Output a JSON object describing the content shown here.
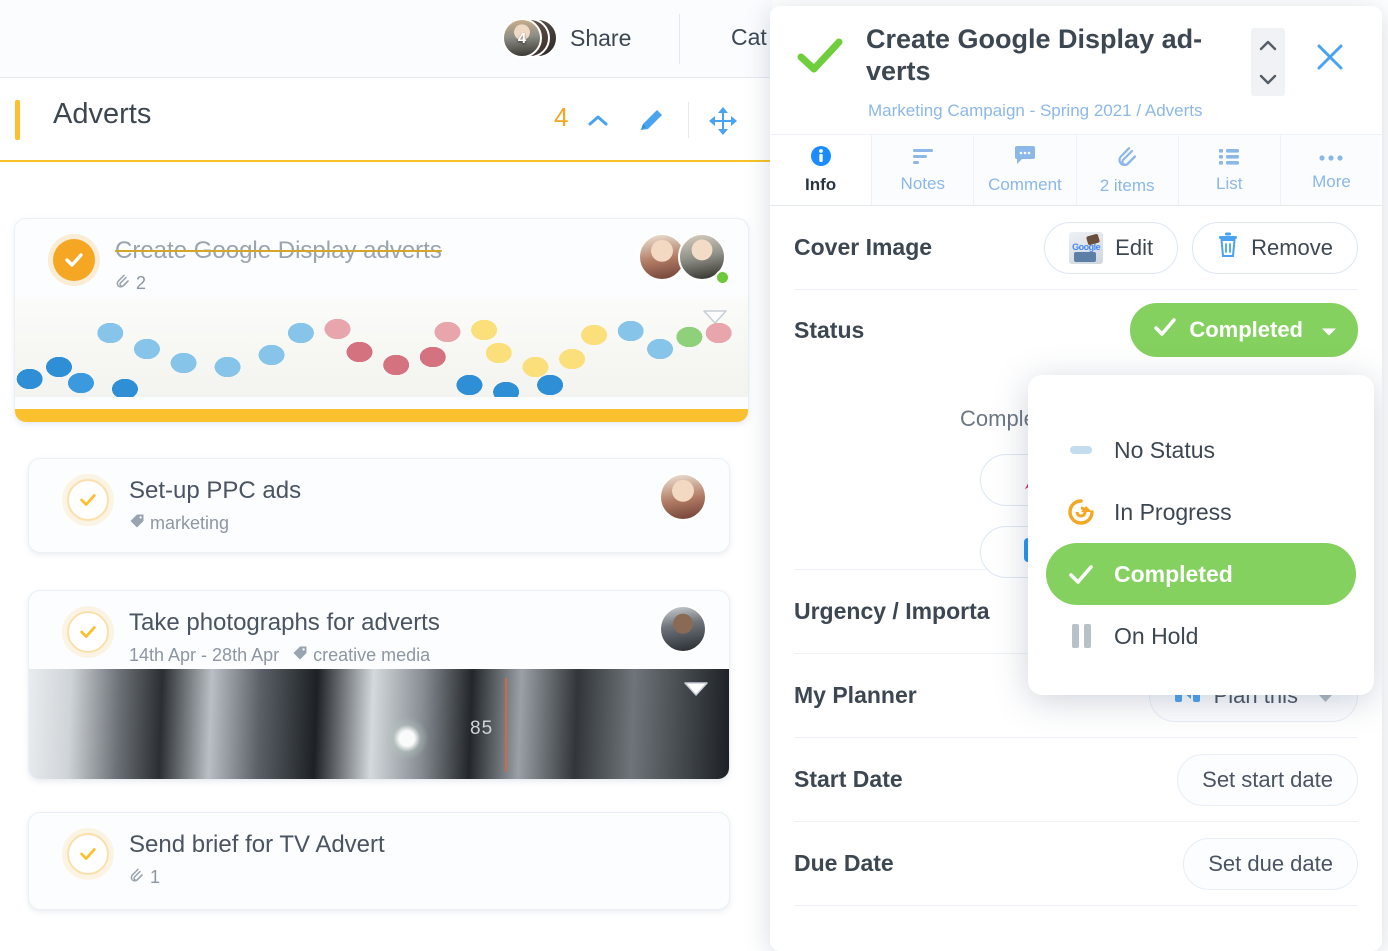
{
  "topbar": {
    "share_label": "Share",
    "avatar_count": "4",
    "cut_label": "Cat"
  },
  "list_header": {
    "title": "Adverts",
    "count": "4",
    "collapse_icon": "chevron-up-icon",
    "edit_icon": "pencil-icon",
    "move_icon": "move-cross-icon",
    "accent_color": "#fbc02d"
  },
  "cards": [
    {
      "title": "Create Google Display adverts",
      "completed": true,
      "attachments": "2",
      "tags": "",
      "dates": "",
      "cover": "candy",
      "avatars": 2,
      "online": true
    },
    {
      "title": "Set-up PPC ads",
      "completed": false,
      "attachments": "",
      "tags": "marketing",
      "dates": "",
      "cover": "",
      "avatars": 1,
      "online": false
    },
    {
      "title": "Take photographs for adverts",
      "completed": false,
      "attachments": "",
      "tags": "creative media",
      "dates": "14th Apr - 28th Apr",
      "cover": "lens",
      "cover_text": "85",
      "avatars": 1,
      "online": false
    },
    {
      "title": "Send brief for TV Advert",
      "completed": false,
      "attachments": "1",
      "tags": "",
      "dates": "",
      "cover": "",
      "avatars": 0,
      "online": false
    }
  ],
  "panel": {
    "title": "Create Google Display ad-verts",
    "breadcrumb": "Marketing Campaign - Spring 2021 / Adverts",
    "close_icon": "close-icon",
    "status_check_icon": "check-icon",
    "tabs": [
      {
        "label": "Info",
        "icon": "info-icon",
        "active": true
      },
      {
        "label": "Notes",
        "icon": "notes-lines-icon",
        "active": false
      },
      {
        "label": "Comment",
        "icon": "comment-bubble-icon",
        "active": false
      },
      {
        "label": "2 items",
        "icon": "paperclip-icon",
        "active": false
      },
      {
        "label": "List",
        "icon": "list-icon",
        "active": false
      },
      {
        "label": "More",
        "icon": "ellipsis-icon",
        "active": false
      }
    ],
    "rows": {
      "cover_image_label": "Cover Image",
      "cover_edit_label": "Edit",
      "cover_remove_label": "Remove",
      "status_label": "Status",
      "status_value": "Completed",
      "completed_note": "Comple",
      "celebrate_icon": "party-popper-icon",
      "archive_icon": "archive-download-icon",
      "urgency_label": "Urgency / Importa",
      "planner_label": "My Planner",
      "planner_value": "Plan this",
      "planner_icon": "planner-icon",
      "start_date_label": "Start Date",
      "start_date_value": "Set start date",
      "due_date_label": "Due Date",
      "due_date_value": "Set due date"
    },
    "status_dropdown": {
      "options": [
        {
          "label": "No Status",
          "icon": "dash-icon",
          "selected": false
        },
        {
          "label": "In Progress",
          "icon": "in-progress-arrow-icon",
          "selected": false
        },
        {
          "label": "Completed",
          "icon": "check-icon",
          "selected": true
        },
        {
          "label": "On Hold",
          "icon": "pause-icon",
          "selected": false
        }
      ]
    }
  },
  "colors": {
    "green": "#85d15f",
    "amber": "#fbc02d",
    "blue": "#4aa3f0",
    "light_blue": "#8bb8e8",
    "text": "#3d4752"
  }
}
